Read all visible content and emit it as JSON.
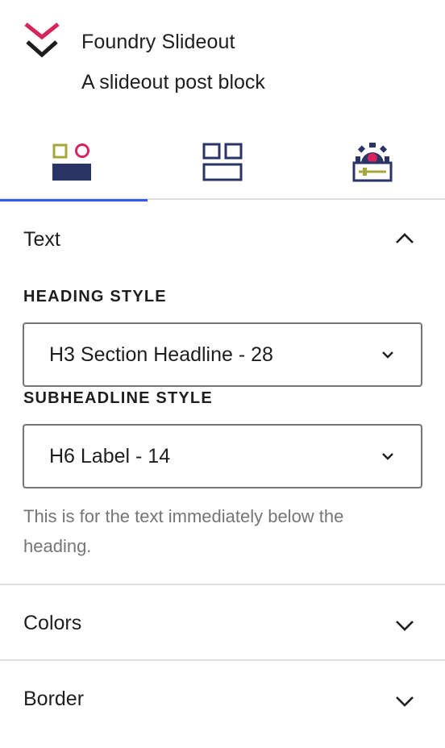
{
  "block": {
    "title": "Foundry Slideout",
    "description": "A slideout post block",
    "logo_icon": "foundry-chevron-logo-icon"
  },
  "tabs": [
    {
      "name": "styles-tab",
      "icon": "styles-icon",
      "active": true
    },
    {
      "name": "layout-tab",
      "icon": "layout-grid-icon",
      "active": false
    },
    {
      "name": "settings-tab",
      "icon": "settings-gear-icon",
      "active": false
    }
  ],
  "panels": {
    "text": {
      "title": "Text",
      "expanded": true,
      "heading_style": {
        "label": "HEADING STYLE",
        "value": "H3 Section Headline - 28"
      },
      "subheadline_style": {
        "label": "SUBHEADLINE STYLE",
        "value": "H6 Label - 14",
        "help": "This is for the text immediately below the heading."
      }
    },
    "colors": {
      "title": "Colors",
      "expanded": false
    },
    "border": {
      "title": "Border",
      "expanded": false
    }
  },
  "colors": {
    "accent": "#3858e9",
    "logo_red": "#d6245c",
    "icon_navy": "#2a3466",
    "icon_olive": "#a5a838"
  }
}
